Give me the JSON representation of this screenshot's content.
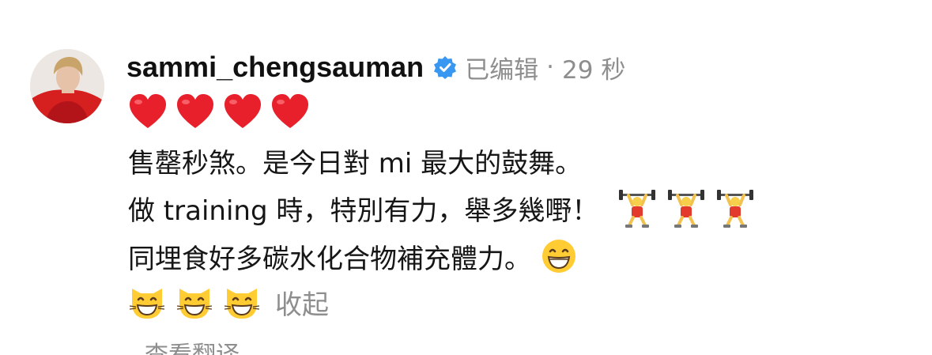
{
  "comment": {
    "username": "sammi_chengsauman",
    "edited_label": "已编辑",
    "separator": "·",
    "time": "29 秒",
    "line1": "售罄秒煞。是今日對 mi 最大的鼓舞。",
    "line2": "做 training 時，特別有力，舉多幾嘢！",
    "line3": "同埋食好多碳水化合物補充體力。",
    "collapse_label": "收起",
    "translate_label": "查看翻译",
    "emojis": {
      "hearts": [
        "red-heart",
        "red-heart",
        "red-heart",
        "red-heart"
      ],
      "lifters": [
        "person-lifting-weights",
        "person-lifting-weights",
        "person-lifting-weights"
      ],
      "smile": "grinning-face-with-smiling-eyes",
      "cats": [
        "grinning-cat",
        "grinning-cat",
        "grinning-cat"
      ]
    }
  },
  "colors": {
    "text": "#161616",
    "muted": "#8e8e8e",
    "verified": "#3897f0",
    "heart": "#e8202b"
  }
}
